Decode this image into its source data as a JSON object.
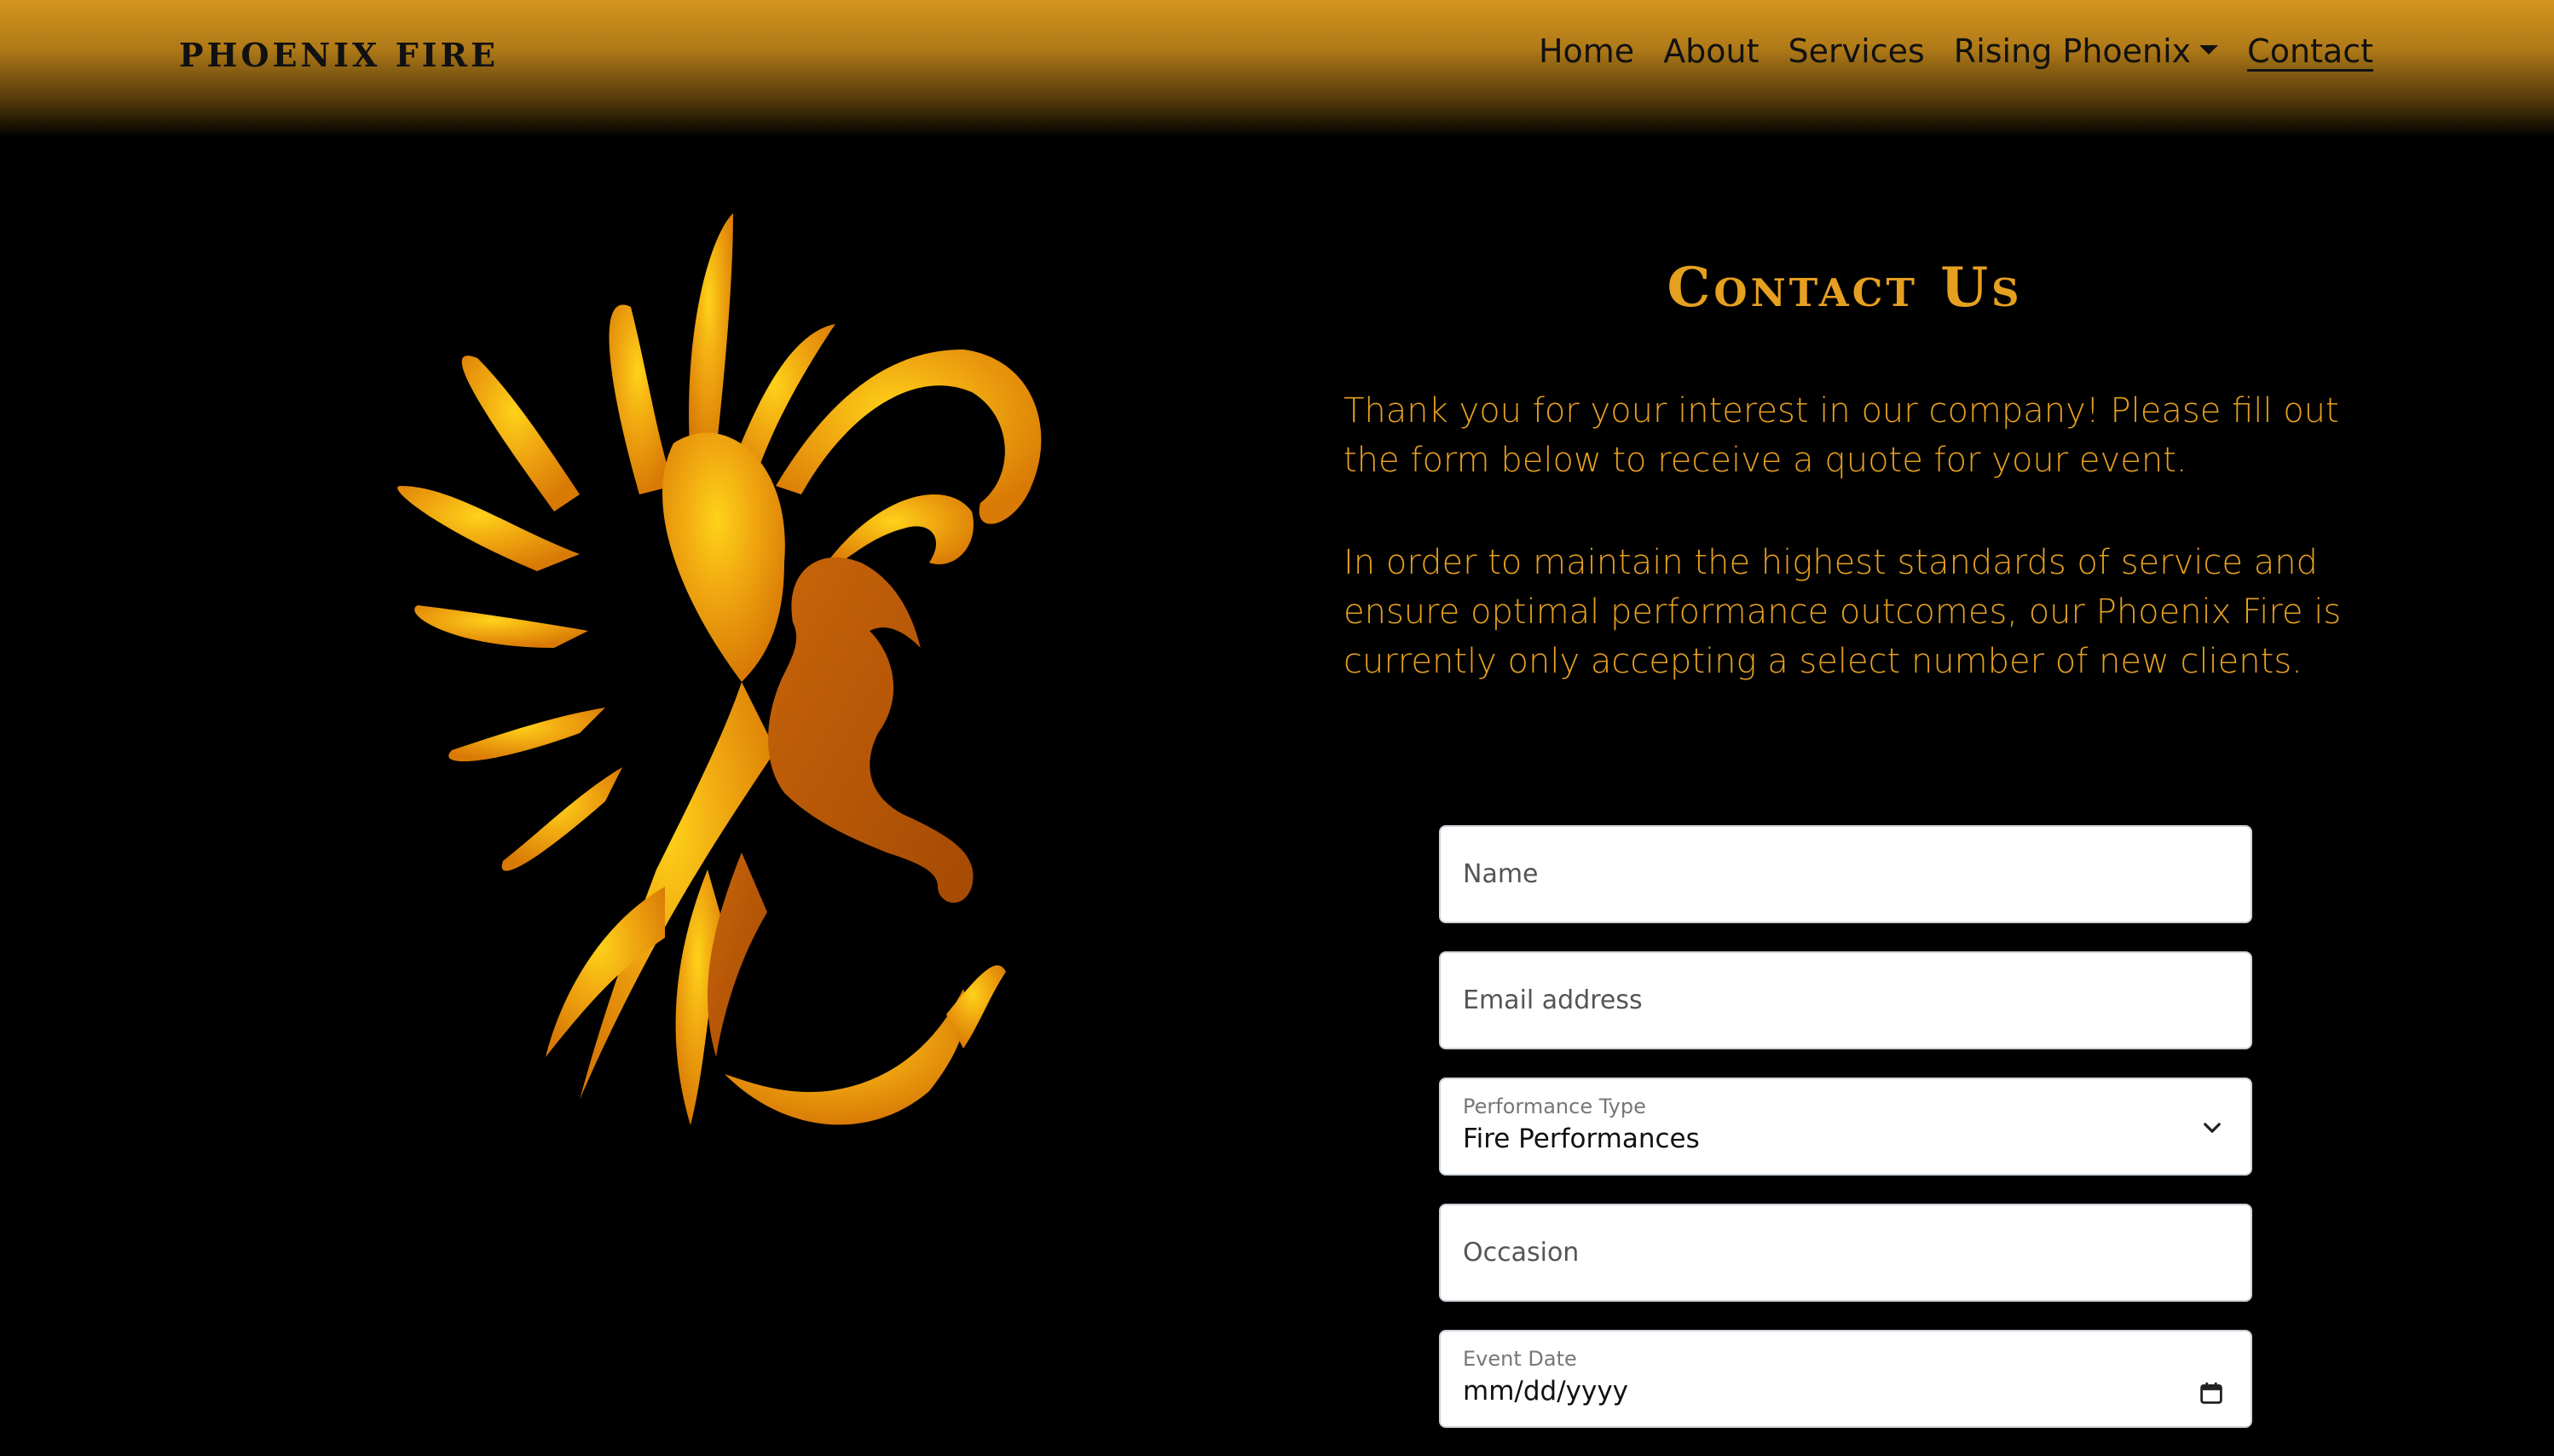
{
  "nav": {
    "brand": "PHOENIX FIRE",
    "links": [
      "Home",
      "About",
      "Services",
      "Rising Phoenix",
      "Contact"
    ]
  },
  "main": {
    "heading": "Contact Us",
    "paragraph1": "Thank you for your interest in our company! Please fill out the form below to receive a quote for your event.",
    "paragraph2": "In order to maintain the highest standards of service and ensure optimal performance outcomes, our Phoenix Fire is currently only accepting a select number of new clients."
  },
  "form": {
    "name_placeholder": "Name",
    "email_placeholder": "Email address",
    "performance_label": "Performance Type",
    "performance_value": "Fire Performances",
    "occasion_placeholder": "Occasion",
    "date_label": "Event Date",
    "date_value": "mm/dd/yyyy"
  },
  "colors": {
    "accent": "#e5a020",
    "nav_gradient_top": "#d4951e"
  },
  "icons": {
    "phoenix": "phoenix-logo",
    "dropdown": "chevron-down-icon",
    "calendar": "calendar-icon"
  }
}
